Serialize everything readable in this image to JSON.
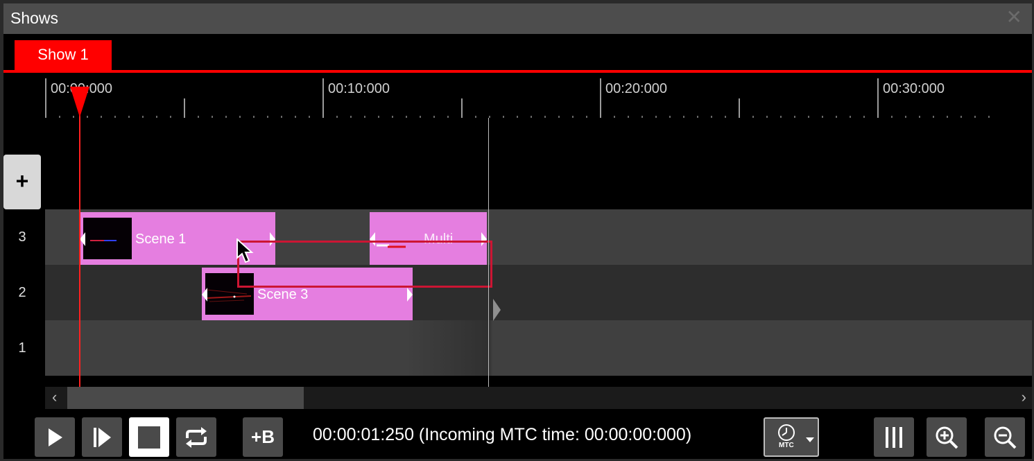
{
  "window": {
    "title": "Shows",
    "close_symbol": "✕"
  },
  "tabs": [
    {
      "label": "Show 1",
      "active": true
    }
  ],
  "ruler": {
    "labels": [
      "00:00:000",
      "00:10:000",
      "00:20:000",
      "00:30:000"
    ]
  },
  "add_track_symbol": "+",
  "tracks": [
    {
      "number": "3"
    },
    {
      "number": "2"
    },
    {
      "number": "1"
    }
  ],
  "clips": [
    {
      "track": "3",
      "label": "Scene 1"
    },
    {
      "track": "3",
      "label": "Multi"
    },
    {
      "track": "2",
      "label": "Scene 3"
    }
  ],
  "transport": {
    "blackout_label": "+B",
    "time_readout": "00:00:01:250 (Incoming MTC time: 00:00:00:000)",
    "mtc_label": "MTC"
  },
  "colors": {
    "accent": "#ff0000",
    "clip": "#e57ee0",
    "selection": "#cc1533",
    "track_dark": "#2d2d2d",
    "track_light": "#404040"
  }
}
